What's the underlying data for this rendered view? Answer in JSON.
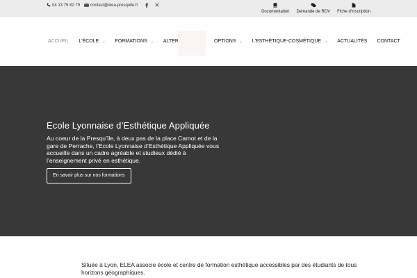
{
  "topbar": {
    "phone": "04 13 75 82 79",
    "email": "contact@elea-presquile.fr",
    "social": [
      "facebook-icon",
      "x-icon"
    ],
    "links": [
      {
        "label": "Documentation",
        "icon": "book-icon"
      },
      {
        "label": "Demande de RDV",
        "icon": "chat-icon"
      },
      {
        "label": "Fiche d'inscription",
        "icon": "document-icon"
      }
    ]
  },
  "nav": {
    "left": [
      {
        "label": "ACCUEIL",
        "active": true,
        "dropdown": false
      },
      {
        "label": "L'ÉCOLE",
        "active": false,
        "dropdown": true
      },
      {
        "label": "FORMATIONS",
        "active": false,
        "dropdown": true
      },
      {
        "label": "ALTERNANCE",
        "active": false,
        "dropdown": false
      }
    ],
    "right": [
      {
        "label": "OPTIONS",
        "active": false,
        "dropdown": true
      },
      {
        "label": "L'ESTHÉTIQUE-COSMÉTIQUE",
        "active": false,
        "dropdown": true
      },
      {
        "label": "ACTUALITÉS",
        "active": false,
        "dropdown": false
      },
      {
        "label": "CONTACT",
        "active": false,
        "dropdown": false
      }
    ]
  },
  "hero": {
    "title": "Ecole Lyonnaise d’Esthétique Appliquée",
    "text": "Au coeur de la Presqu’île, à deux pas de la place Carnot et de la gare de Perrache, l’Ecole Lyonnaise d’Esthétique Appliquée vous accueille dans un cadre agréable et studieux dédié à l’enseignement privé en esthétique.",
    "button": "En savoir plus sur nos formations"
  },
  "intro": {
    "text": "Située à Lyon, ELEA associe école et centre de formation esthétique accessibles par des étudiants de tous horizons géographiques."
  },
  "colors": {
    "hero_bg": "#383838",
    "topbar_bg": "#ececec",
    "active_nav": "#8c8c8c"
  }
}
